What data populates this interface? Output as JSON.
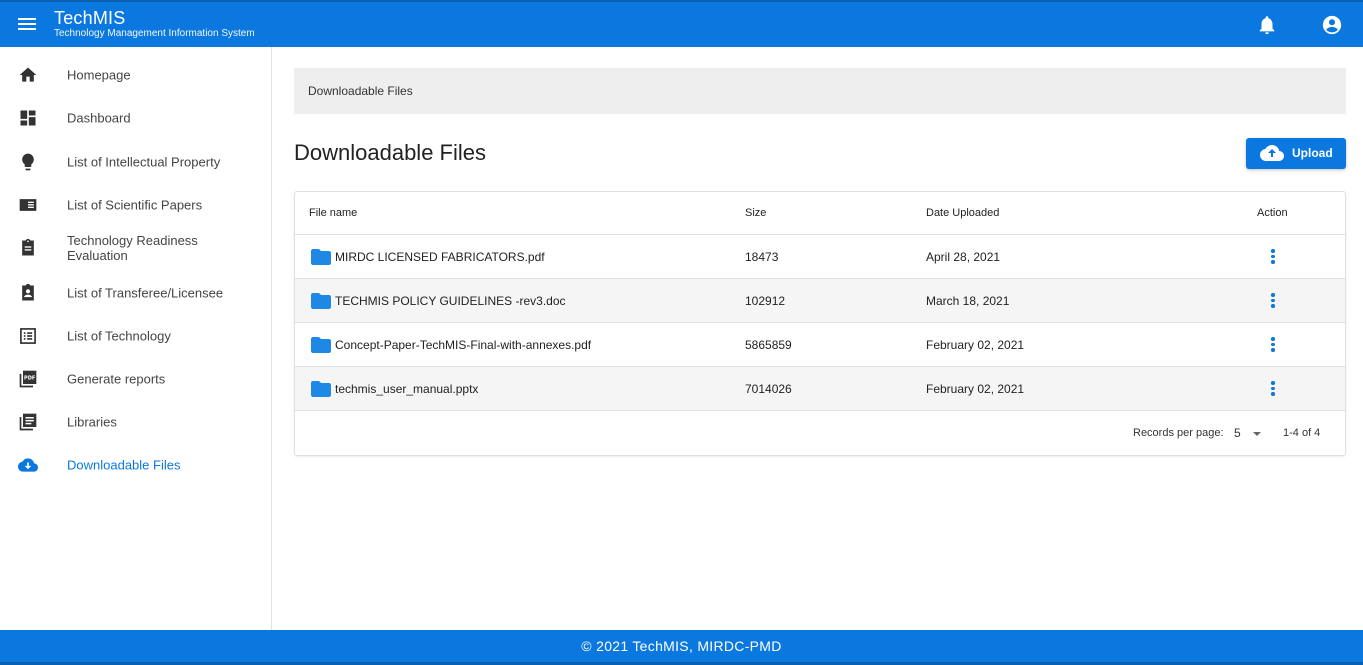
{
  "app": {
    "title": "TechMIS",
    "subtitle": "Technology Management Information System"
  },
  "header": {
    "menu_icon": "hamburger-menu-icon",
    "notification_icon": "bell-icon",
    "account_icon": "account-circle-icon"
  },
  "sidebar": {
    "items": [
      {
        "label": "Homepage",
        "icon": "home-icon"
      },
      {
        "label": "Dashboard",
        "icon": "dashboard-icon"
      },
      {
        "label": "List of Intellectual Property",
        "icon": "lightbulb-icon"
      },
      {
        "label": "List of Scientific Papers",
        "icon": "book-icon"
      },
      {
        "label": "Technology Readiness Evaluation",
        "icon": "clipboard-icon"
      },
      {
        "label": "List of Transferee/Licensee",
        "icon": "clipboard-account-icon"
      },
      {
        "label": "List of Technology",
        "icon": "list-box-icon"
      },
      {
        "label": "Generate reports",
        "icon": "pdf-icon"
      },
      {
        "label": "Libraries",
        "icon": "library-icon"
      },
      {
        "label": "Downloadable Files",
        "icon": "cloud-download-icon",
        "active": true
      }
    ]
  },
  "breadcrumb": {
    "text": "Downloadable Files"
  },
  "main": {
    "title": "Downloadable Files",
    "upload_label": "Upload"
  },
  "table": {
    "headers": {
      "name": "File name",
      "size": "Size",
      "date": "Date Uploaded",
      "action": "Action"
    },
    "rows": [
      {
        "name": "MIRDC LICENSED FABRICATORS.pdf",
        "size": "18473",
        "date": "April 28, 2021"
      },
      {
        "name": "TECHMIS POLICY GUIDELINES -rev3.doc",
        "size": "102912",
        "date": "March 18, 2021"
      },
      {
        "name": "Concept-Paper-TechMIS-Final-with-annexes.pdf",
        "size": "5865859",
        "date": "February 02, 2021"
      },
      {
        "name": "techmis_user_manual.pptx",
        "size": "7014026",
        "date": "February 02, 2021"
      }
    ],
    "pagination": {
      "records_label": "Records per page:",
      "records_value": "5",
      "range": "1-4 of 4"
    }
  },
  "footer": {
    "text": "© 2021 TechMIS, MIRDC-PMD"
  },
  "colors": {
    "primary": "#0a78df",
    "folder": "#1e88e5"
  }
}
